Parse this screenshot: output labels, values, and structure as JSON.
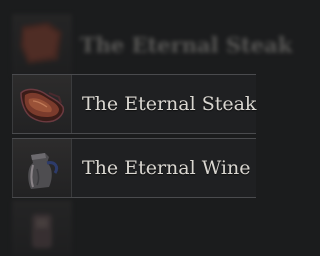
{
  "items": [
    {
      "name": "The Eternal Steak",
      "icon": "steak-icon",
      "state": "blurred"
    },
    {
      "name": "The Eternal Steak",
      "icon": "steak-icon",
      "state": "selected"
    },
    {
      "name": "The Eternal Wine",
      "icon": "wine-jug-icon",
      "state": "normal"
    },
    {
      "name": "",
      "icon": "unknown-item-icon",
      "state": "blurred"
    }
  ],
  "colors": {
    "background": "#1b1c1d",
    "row_border": "#4a4b4e",
    "label_text": "#d9d6d0",
    "steak_meat": "#7b3b2c",
    "wine_jug": "#5a5a5e"
  }
}
